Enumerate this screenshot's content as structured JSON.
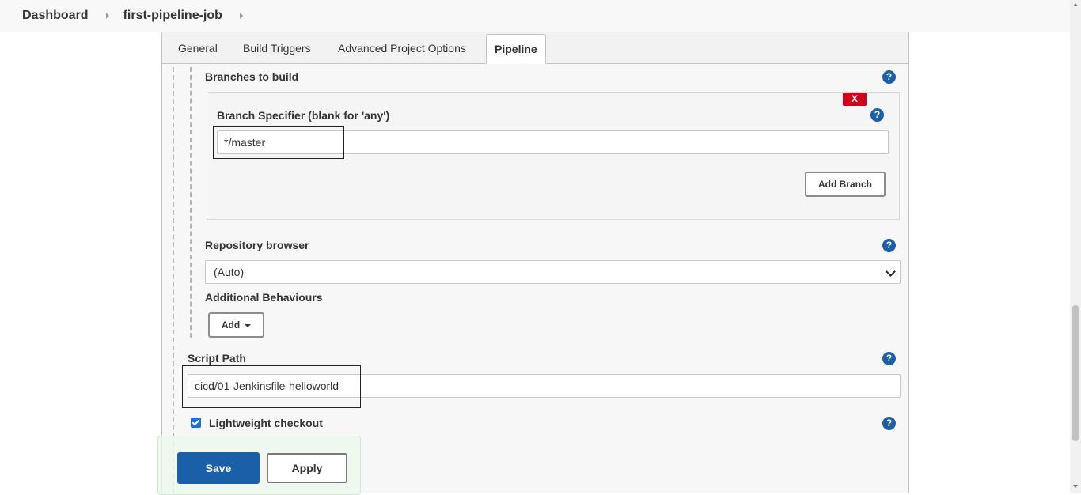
{
  "breadcrumb": {
    "items": [
      "Dashboard",
      "first-pipeline-job"
    ]
  },
  "tabs": [
    {
      "label": "General",
      "active": false
    },
    {
      "label": "Build Triggers",
      "active": false
    },
    {
      "label": "Advanced Project Options",
      "active": false
    },
    {
      "label": "Pipeline",
      "active": true
    }
  ],
  "pipeline": {
    "branches_label": "Branches to build",
    "branch_specifier_label": "Branch Specifier (blank for 'any')",
    "branch_specifier_value": "*/master",
    "delete_label": "X",
    "add_branch_label": "Add Branch",
    "repo_browser_label": "Repository browser",
    "repo_browser_value": "(Auto)",
    "additional_behaviours_label": "Additional Behaviours",
    "add_label": "Add",
    "script_path_label": "Script Path",
    "script_path_value": "cicd/01-Jenkinsfile-helloworld",
    "lightweight_checkout_label": "Lightweight checkout",
    "lightweight_checkout_checked": true,
    "help_glyph": "?"
  },
  "actions": {
    "save_label": "Save",
    "apply_label": "Apply"
  },
  "colors": {
    "primary": "#1a5fa8",
    "danger": "#d0021b",
    "checkbox": "#1a6fd8"
  }
}
